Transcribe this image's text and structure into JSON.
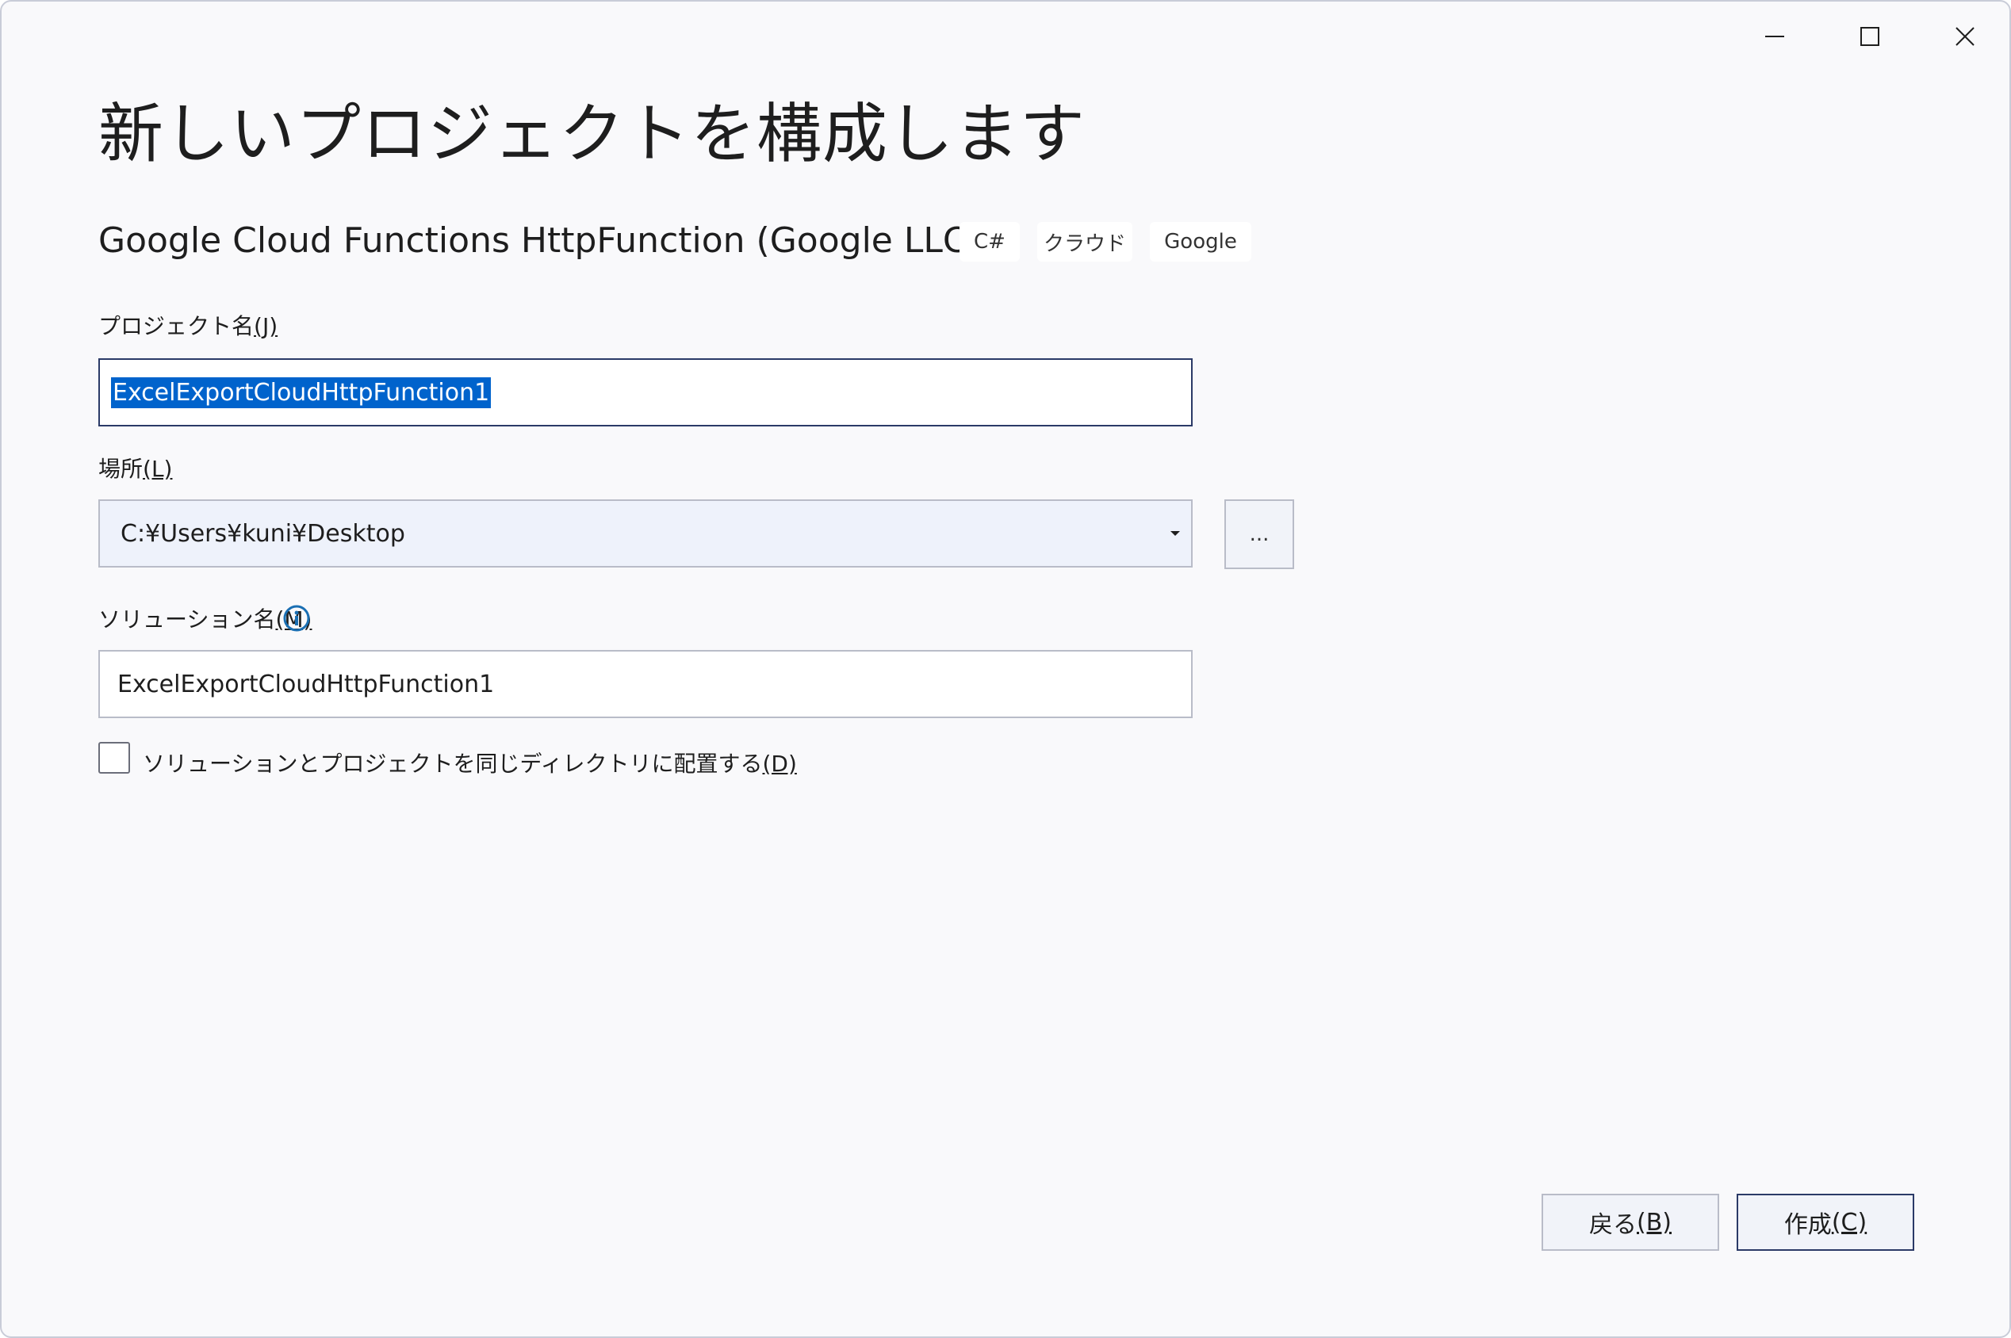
{
  "window": {
    "controls": {
      "minimize": "minimize-icon",
      "maximize": "maximize-icon",
      "close": "close-icon"
    }
  },
  "header": {
    "title": "新しいプロジェクトを構成します",
    "template_name": "Google Cloud Functions HttpFunction (Google LLC)",
    "tags": [
      "C#",
      "クラウド",
      "Google"
    ]
  },
  "form": {
    "project_name": {
      "label_text": "プロジェクト名",
      "label_key": "(J)",
      "value": "ExcelExportCloudHttpFunction1"
    },
    "location": {
      "label_text": "場所",
      "label_key": "(L)",
      "value": "C:¥Users¥kuni¥Desktop",
      "browse_label": "..."
    },
    "solution_name": {
      "label_text": "ソリューション名",
      "label_key": "(M)",
      "value": "ExcelExportCloudHttpFunction1"
    },
    "same_dir": {
      "label_text": "ソリューションとプロジェクトを同じディレクトリに配置する",
      "label_key": "(D)",
      "checked": false
    }
  },
  "footer": {
    "back_label": "戻る",
    "back_key": "(B)",
    "create_label": "作成",
    "create_key": "(C)"
  },
  "colors": {
    "accent": "#0063cc",
    "border_focus": "#2b3a67",
    "info": "#1a6fb3"
  }
}
